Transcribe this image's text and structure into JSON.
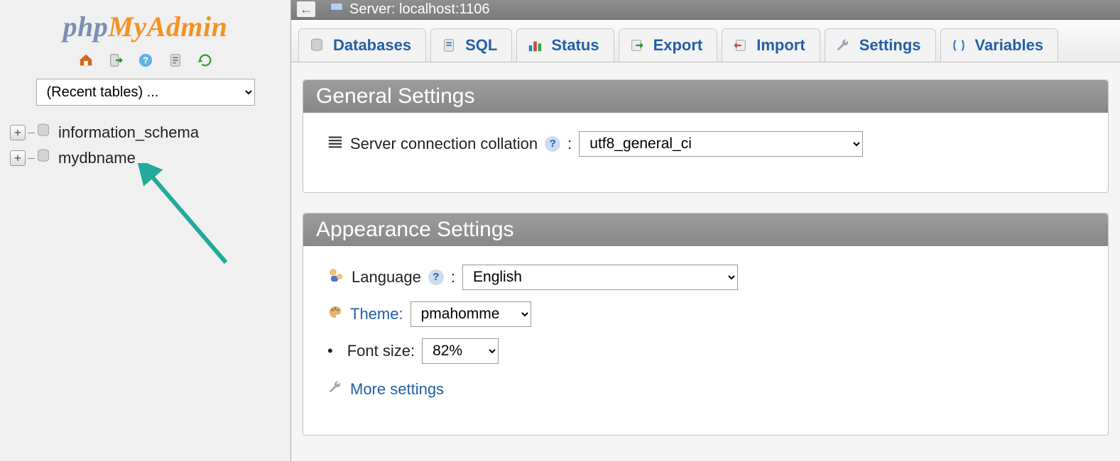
{
  "logo": {
    "php": "php",
    "my": "My",
    "admin": "Admin"
  },
  "sidebar": {
    "recent_placeholder": "(Recent tables) ...",
    "databases": [
      {
        "name": "information_schema"
      },
      {
        "name": "mydbname"
      }
    ],
    "toolbar": [
      "home",
      "logout",
      "help",
      "sql",
      "refresh"
    ]
  },
  "server": {
    "label": "Server: localhost:1106"
  },
  "tabs": [
    {
      "icon": "db",
      "label": "Databases"
    },
    {
      "icon": "sql",
      "label": "SQL"
    },
    {
      "icon": "status",
      "label": "Status"
    },
    {
      "icon": "export",
      "label": "Export"
    },
    {
      "icon": "import",
      "label": "Import"
    },
    {
      "icon": "wrench",
      "label": "Settings"
    },
    {
      "icon": "vars",
      "label": "Variables"
    }
  ],
  "panels": {
    "general": {
      "title": "General Settings",
      "collation_label": "Server connection collation",
      "collation_value": "utf8_general_ci"
    },
    "appearance": {
      "title": "Appearance Settings",
      "language_label": "Language",
      "language_value": "English",
      "theme_label": "Theme:",
      "theme_value": "pmahomme",
      "fontsize_label": "Font size:",
      "fontsize_value": "82%",
      "more_settings": "More settings"
    }
  }
}
